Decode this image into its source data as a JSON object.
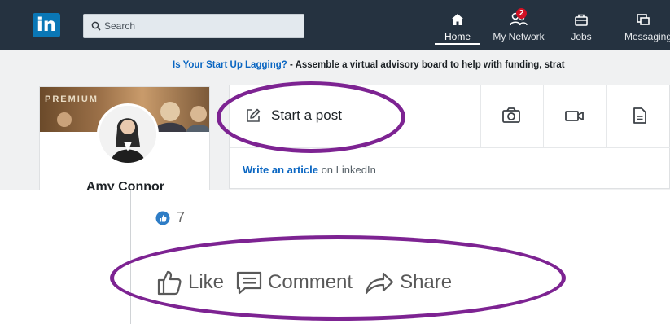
{
  "navbar": {
    "logo": "in",
    "search_placeholder": "Search",
    "items": [
      {
        "label": "Home",
        "icon": "home-icon",
        "active": true
      },
      {
        "label": "My Network",
        "icon": "network-icon",
        "badge": "2"
      },
      {
        "label": "Jobs",
        "icon": "briefcase-icon"
      },
      {
        "label": "Messaging",
        "icon": "messaging-icon"
      }
    ]
  },
  "promo": {
    "link": "Is Your Start Up Lagging?",
    "text": " - Assemble a virtual advisory board to help with funding, strat"
  },
  "profile": {
    "premium_label": "PREMIUM",
    "name": "Amy Connor"
  },
  "post_box": {
    "start_post_label": "Start a post",
    "actions": [
      "camera-icon",
      "video-icon",
      "document-icon"
    ],
    "write_article_link": "Write an article",
    "write_article_rest": " on LinkedIn"
  },
  "post": {
    "reaction_count": "7",
    "actions": [
      {
        "label": "Like",
        "icon": "thumbs-up-icon"
      },
      {
        "label": "Comment",
        "icon": "comment-icon"
      },
      {
        "label": "Share",
        "icon": "share-arrow-icon"
      }
    ]
  },
  "colors": {
    "navbar_bg": "#253240",
    "linkedin_blue": "#0a66c2",
    "highlight_purple": "#7d2392",
    "badge_red": "#d11124"
  }
}
